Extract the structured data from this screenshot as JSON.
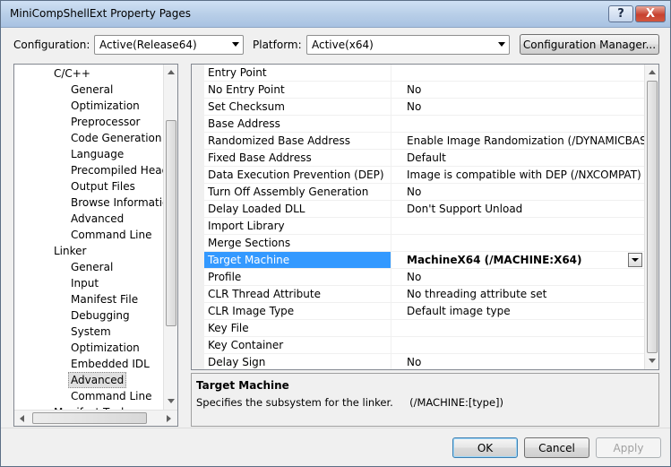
{
  "window": {
    "title": "MiniCompShellExt Property Pages",
    "help_glyph": "?",
    "close_glyph": "X"
  },
  "toolbar": {
    "configuration_label": "Configuration:",
    "configuration_value": "Active(Release64)",
    "platform_label": "Platform:",
    "platform_value": "Active(x64)",
    "config_manager_label": "Configuration Manager..."
  },
  "tree": {
    "items": [
      {
        "label": "C/C++",
        "level": 1
      },
      {
        "label": "General",
        "level": 2
      },
      {
        "label": "Optimization",
        "level": 2
      },
      {
        "label": "Preprocessor",
        "level": 2
      },
      {
        "label": "Code Generation",
        "level": 2
      },
      {
        "label": "Language",
        "level": 2
      },
      {
        "label": "Precompiled Heade",
        "level": 2
      },
      {
        "label": "Output Files",
        "level": 2
      },
      {
        "label": "Browse Information",
        "level": 2
      },
      {
        "label": "Advanced",
        "level": 2
      },
      {
        "label": "Command Line",
        "level": 2
      },
      {
        "label": "Linker",
        "level": 1
      },
      {
        "label": "General",
        "level": 2
      },
      {
        "label": "Input",
        "level": 2
      },
      {
        "label": "Manifest File",
        "level": 2
      },
      {
        "label": "Debugging",
        "level": 2
      },
      {
        "label": "System",
        "level": 2
      },
      {
        "label": "Optimization",
        "level": 2
      },
      {
        "label": "Embedded IDL",
        "level": 2
      },
      {
        "label": "Advanced",
        "level": 2,
        "selected": true
      },
      {
        "label": "Command Line",
        "level": 2
      },
      {
        "label": "Manifest Tool",
        "level": 1
      }
    ]
  },
  "grid": {
    "rows": [
      {
        "name": "Entry Point",
        "value": ""
      },
      {
        "name": "No Entry Point",
        "value": "No"
      },
      {
        "name": "Set Checksum",
        "value": "No"
      },
      {
        "name": "Base Address",
        "value": ""
      },
      {
        "name": "Randomized Base Address",
        "value": "Enable Image Randomization (/DYNAMICBASE)"
      },
      {
        "name": "Fixed Base Address",
        "value": "Default"
      },
      {
        "name": "Data Execution Prevention (DEP)",
        "value": "Image is compatible with DEP (/NXCOMPAT)"
      },
      {
        "name": "Turn Off Assembly Generation",
        "value": "No"
      },
      {
        "name": "Delay Loaded DLL",
        "value": "Don't Support Unload"
      },
      {
        "name": "Import Library",
        "value": ""
      },
      {
        "name": "Merge Sections",
        "value": ""
      },
      {
        "name": "Target Machine",
        "value": "MachineX64 (/MACHINE:X64)",
        "selected": true
      },
      {
        "name": "Profile",
        "value": "No"
      },
      {
        "name": "CLR Thread Attribute",
        "value": "No threading attribute set"
      },
      {
        "name": "CLR Image Type",
        "value": "Default image type"
      },
      {
        "name": "Key File",
        "value": ""
      },
      {
        "name": "Key Container",
        "value": ""
      },
      {
        "name": "Delay Sign",
        "value": "No"
      }
    ]
  },
  "description": {
    "title": "Target Machine",
    "text": "Specifies the subsystem for the linker.     (/MACHINE:[type])"
  },
  "buttons": {
    "ok": "OK",
    "cancel": "Cancel",
    "apply": "Apply"
  }
}
